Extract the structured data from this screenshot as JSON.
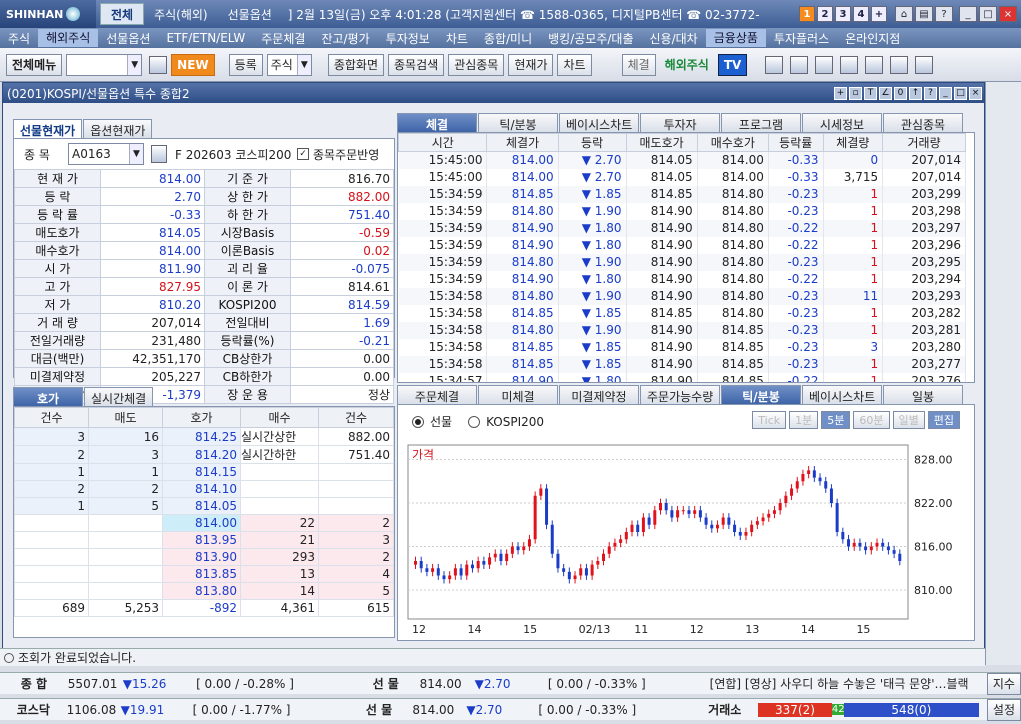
{
  "app": {
    "brand": "SHINHAN",
    "top_tabs": [
      "전체",
      "주식(해외)",
      "선물옵션"
    ],
    "ticker": "] 2월 13일(금) 오후 4:01:28 (고객지원센터 ☎ 1588-0365, 디지털PB센터 ☎ 02-3772-",
    "num_buttons": [
      "1",
      "2",
      "3",
      "4",
      "+"
    ]
  },
  "menu": [
    "주식",
    "해외주식",
    "선물옵션",
    "ETF/ETN/ELW",
    "주문체결",
    "잔고/평가",
    "투자정보",
    "차트",
    "종합/미니",
    "뱅킹/공모주/대출",
    "신용/대차",
    "금융상품",
    "투자플러스",
    "온라인지점"
  ],
  "toolbar": {
    "allmenu": "전체메뉴",
    "new": "NEW",
    "reg": "등록",
    "stock": "주식",
    "combo": "종합화면",
    "search": "종목검색",
    "interest": "관심종목",
    "cur": "현재가",
    "chart": "차트",
    "sign": "체결",
    "overseas": "해외주식",
    "tv": "TV"
  },
  "window": {
    "title": "(0201)KOSPI/선물옵션 특수 종합2"
  },
  "left": {
    "tabs": [
      "선물현재가",
      "옵션현재가"
    ],
    "code_label": "종 목",
    "code": "A0163",
    "name": "F 202603 코스피200",
    "order_check": "종목주문반영",
    "rows": [
      [
        "현 재 가",
        "814.00",
        "blue",
        "기 준 가",
        "816.70",
        ""
      ],
      [
        "등 락",
        "2.70",
        "blue",
        "상 한 가",
        "882.00",
        "red"
      ],
      [
        "등 락 률",
        "-0.33",
        "blue",
        "하 한 가",
        "751.40",
        "blue"
      ],
      [
        "매도호가",
        "814.05",
        "blue",
        "시장Basis",
        "-0.59",
        "red"
      ],
      [
        "매수호가",
        "814.00",
        "blue",
        "이론Basis",
        "0.02",
        "red"
      ],
      [
        "시 가",
        "811.90",
        "blue",
        "괴 리 율",
        "-0.075",
        "blue"
      ],
      [
        "고 가",
        "827.95",
        "red",
        "이 론 가",
        "814.61",
        ""
      ],
      [
        "저 가",
        "810.20",
        "blue",
        "KOSPI200",
        "814.59",
        "blue"
      ],
      [
        "거 래 량",
        "207,014",
        "",
        "전일대비",
        "1.69",
        "blue"
      ],
      [
        "전일거래량",
        "231,480",
        "",
        "등락률(%)",
        "-0.21",
        "blue"
      ],
      [
        "대금(백만)",
        "42,351,170",
        "",
        "CB상한가",
        "0.00",
        ""
      ],
      [
        "미결제약정",
        "205,227",
        "",
        "CB하한가",
        "0.00",
        ""
      ],
      [
        "미결제증감",
        "-1,379",
        "blue",
        "장 운 용",
        "정상",
        ""
      ]
    ]
  },
  "hoga": {
    "tabs": [
      "호가",
      "실시간체결"
    ],
    "headers": [
      "건수",
      "매도",
      "호가",
      "매수",
      "건수"
    ],
    "asks": [
      [
        "3",
        "16",
        "814.25"
      ],
      [
        "2",
        "3",
        "814.20"
      ],
      [
        "1",
        "1",
        "814.15"
      ],
      [
        "2",
        "2",
        "814.10"
      ],
      [
        "1",
        "5",
        "814.05"
      ]
    ],
    "bids": [
      [
        "814.00",
        "22",
        "2"
      ],
      [
        "813.95",
        "21",
        "3"
      ],
      [
        "813.90",
        "293",
        "2"
      ],
      [
        "813.85",
        "13",
        "4"
      ],
      [
        "813.80",
        "14",
        "5"
      ]
    ],
    "limit_up_label": "실시간상한",
    "limit_up": "882.00",
    "limit_dn_label": "실시간하한",
    "limit_dn": "751.40",
    "totals": [
      "689",
      "5,253",
      "-892",
      "4,361",
      "615"
    ]
  },
  "trades": {
    "tabs": [
      "체결",
      "틱/분봉",
      "베이시스차트",
      "투자자",
      "프로그램",
      "시세정보",
      "관심종목"
    ],
    "headers": [
      "시간",
      "체결가",
      "등락",
      "매도호가",
      "매수호가",
      "등락률",
      "체결량",
      "거래량"
    ],
    "rows": [
      [
        "15:45:00",
        "814.00",
        "2.70",
        "814.05",
        "814.00",
        "-0.33",
        "0",
        "207,014"
      ],
      [
        "15:45:00",
        "814.00",
        "2.70",
        "814.05",
        "814.00",
        "-0.33",
        "3,715",
        "207,014"
      ],
      [
        "15:34:59",
        "814.85",
        "1.85",
        "814.85",
        "814.80",
        "-0.23",
        "1",
        "203,299"
      ],
      [
        "15:34:59",
        "814.80",
        "1.90",
        "814.90",
        "814.80",
        "-0.23",
        "1",
        "203,298"
      ],
      [
        "15:34:59",
        "814.90",
        "1.80",
        "814.90",
        "814.80",
        "-0.22",
        "1",
        "203,297"
      ],
      [
        "15:34:59",
        "814.90",
        "1.80",
        "814.90",
        "814.80",
        "-0.22",
        "1",
        "203,296"
      ],
      [
        "15:34:59",
        "814.80",
        "1.90",
        "814.90",
        "814.80",
        "-0.23",
        "1",
        "203,295"
      ],
      [
        "15:34:59",
        "814.90",
        "1.80",
        "814.90",
        "814.80",
        "-0.22",
        "1",
        "203,294"
      ],
      [
        "15:34:58",
        "814.80",
        "1.90",
        "814.90",
        "814.80",
        "-0.23",
        "11",
        "203,293"
      ],
      [
        "15:34:58",
        "814.85",
        "1.85",
        "814.85",
        "814.80",
        "-0.23",
        "1",
        "203,282"
      ],
      [
        "15:34:58",
        "814.80",
        "1.90",
        "814.90",
        "814.85",
        "-0.23",
        "1",
        "203,281"
      ],
      [
        "15:34:58",
        "814.85",
        "1.85",
        "814.90",
        "814.85",
        "-0.23",
        "3",
        "203,280"
      ],
      [
        "15:34:58",
        "814.85",
        "1.85",
        "814.90",
        "814.85",
        "-0.23",
        "1",
        "203,277"
      ],
      [
        "15:34:57",
        "814.90",
        "1.80",
        "814.90",
        "814.85",
        "-0.22",
        "1",
        "203,276"
      ]
    ]
  },
  "chart": {
    "tabs": [
      "주문체결",
      "미체결",
      "미결제약정",
      "주문가능수량",
      "틱/분봉",
      "베이시스차트",
      "일봉"
    ],
    "radio1": "선물",
    "radio2": "KOSPI200",
    "periods": [
      "Tick",
      "1분",
      "5분",
      "60분",
      "일별"
    ],
    "edit": "편집",
    "price_label": "가격",
    "yticks": [
      "828.00",
      "822.00",
      "816.00",
      "810.00"
    ],
    "xticks": [
      "12",
      "14",
      "15",
      "02/13",
      "11",
      "12",
      "13",
      "14",
      "15"
    ]
  },
  "chart_data": {
    "type": "candlestick",
    "ylim": [
      806,
      830
    ],
    "ylabel": "가격",
    "values": [
      814,
      813,
      812.5,
      813,
      812,
      811.5,
      812,
      813,
      812,
      813.5,
      813,
      814,
      813.5,
      814.5,
      815,
      814,
      815,
      816,
      815.5,
      816,
      817,
      823,
      824,
      819,
      815,
      813,
      812.5,
      811.5,
      812,
      813,
      812,
      813.5,
      814,
      815,
      816,
      816.5,
      817,
      818,
      819,
      818,
      820,
      819,
      821,
      822,
      821,
      820,
      821,
      821,
      820.5,
      821,
      820,
      819,
      818.5,
      819,
      820,
      819,
      818,
      817.5,
      818,
      819,
      819.5,
      820,
      820.5,
      821,
      822,
      823,
      824,
      825,
      826,
      826.5,
      825.5,
      825,
      824,
      822,
      818,
      817,
      816,
      816.5,
      816,
      815.5,
      816,
      816.5,
      816,
      815.5,
      815,
      814
    ]
  },
  "status": "조회가 완료되었습니다.",
  "bottom1": {
    "k1": "종 합",
    "v1": "5507.01",
    "d1": "▼15.26",
    "p1": "[ 0.00 / -0.28% ]",
    "k2": "선 물",
    "v2": "814.00",
    "d2": "▼2.70",
    "p2": "[ 0.00 / -0.33% ]",
    "news": "[연합] [영상] 사우디 하늘 수놓은 '태극 문양'…블랙",
    "btn": "지수"
  },
  "bottom2": {
    "k1": "코스닥",
    "v1": "1106.08",
    "d1": "▼19.91",
    "p1": "[ 0.00 / -1.77% ]",
    "k2": "선 물",
    "v2": "814.00",
    "d2": "▼2.70",
    "p2": "[ 0.00 / -0.33% ]",
    "k3": "거래소",
    "up": "337(2)",
    "flat": "42",
    "down": "548(0)",
    "btn": "설정"
  }
}
